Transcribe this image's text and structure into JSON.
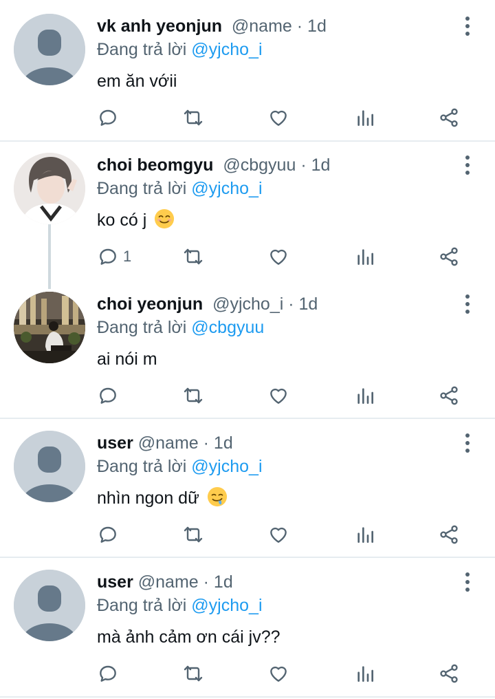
{
  "tweets": [
    {
      "display_name": "vk anh yeonjun",
      "handle": "@name",
      "dot": "·",
      "time": "1d",
      "replying_prefix": "Đang trả lời",
      "replying_to": "@yjcho_i",
      "text": "em ăn vớii",
      "reply_count": ""
    },
    {
      "display_name": "choi beomgyu",
      "handle": "@cbgyuu",
      "dot": "·",
      "time": "1d",
      "replying_prefix": "Đang trả lời",
      "replying_to": "@yjcho_i",
      "text": "ko có j",
      "reply_count": "1"
    },
    {
      "display_name": "choi yeonjun",
      "handle": "@yjcho_i",
      "dot": "·",
      "time": "1d",
      "replying_prefix": "Đang trả lời",
      "replying_to": "@cbgyuu",
      "text": "ai nói m",
      "reply_count": ""
    },
    {
      "display_name": "user",
      "handle": "@name",
      "dot": "·",
      "time": "1d",
      "replying_prefix": "Đang trả lời",
      "replying_to": "@yjcho_i",
      "text": "nhìn ngon dữ",
      "reply_count": ""
    },
    {
      "display_name": "user",
      "handle": "@name",
      "dot": "·",
      "time": "1d",
      "replying_prefix": "Đang trả lời",
      "replying_to": "@yjcho_i",
      "text": "mà ảnh cảm ơn cái jv??",
      "reply_count": ""
    }
  ],
  "emojis": {
    "tweet2": "smiling-face-emoji",
    "tweet4": "drooling-face-emoji"
  },
  "colors": {
    "mention": "#1d9bf0",
    "secondary_text": "#536471",
    "divider": "#e6ecf0",
    "placeholder_avatar": "#c8d1d9"
  }
}
